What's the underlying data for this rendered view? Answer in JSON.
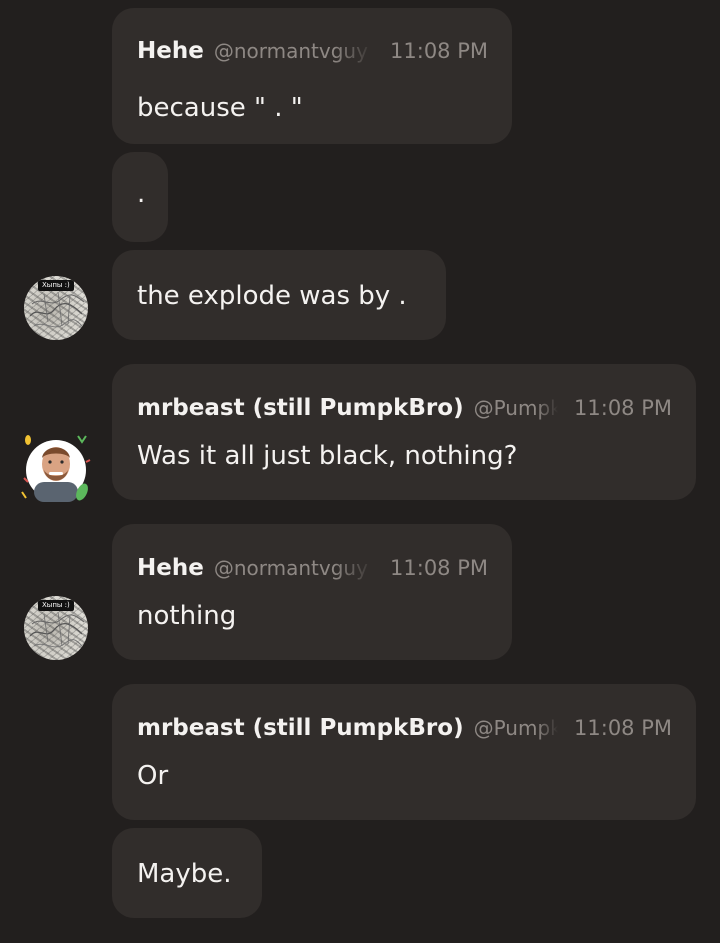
{
  "messages": [
    {
      "author": "Hehe",
      "handle": "@normantvguy",
      "time": "11:08 PM",
      "text": "because \" . \""
    },
    {
      "text": "."
    },
    {
      "text": "the explode was by .",
      "avatar_tag": "Хыпы :)"
    },
    {
      "author": "mrbeast (still PumpkBro)",
      "handle": "@PumpkBro",
      "time": "11:08 PM",
      "text": "Was it all just black, nothing?"
    },
    {
      "author": "Hehe",
      "handle": "@normantvguy",
      "time": "11:08 PM",
      "text": "nothing",
      "avatar_tag": "Хыпы :)"
    },
    {
      "author": "mrbeast (still PumpkBro)",
      "handle": "@PumpkBro",
      "time": "11:08 PM",
      "text": "Or"
    },
    {
      "text": "Maybe."
    }
  ],
  "avatars": {
    "hehe": {
      "icon": "sketch-avatar",
      "colors": [
        "#e9e7e2",
        "#b9b6ae"
      ]
    },
    "mrbeast": {
      "icon": "mrbeast-avatar",
      "colors": [
        "#8b5a3c",
        "#5a6470",
        "#f1c232",
        "#5cb85c",
        "#d9534f"
      ]
    }
  },
  "theme": {
    "background": "#221f1e",
    "bubble": "#312d2b",
    "text": "#f2f0ee",
    "muted": "#8e8884"
  }
}
